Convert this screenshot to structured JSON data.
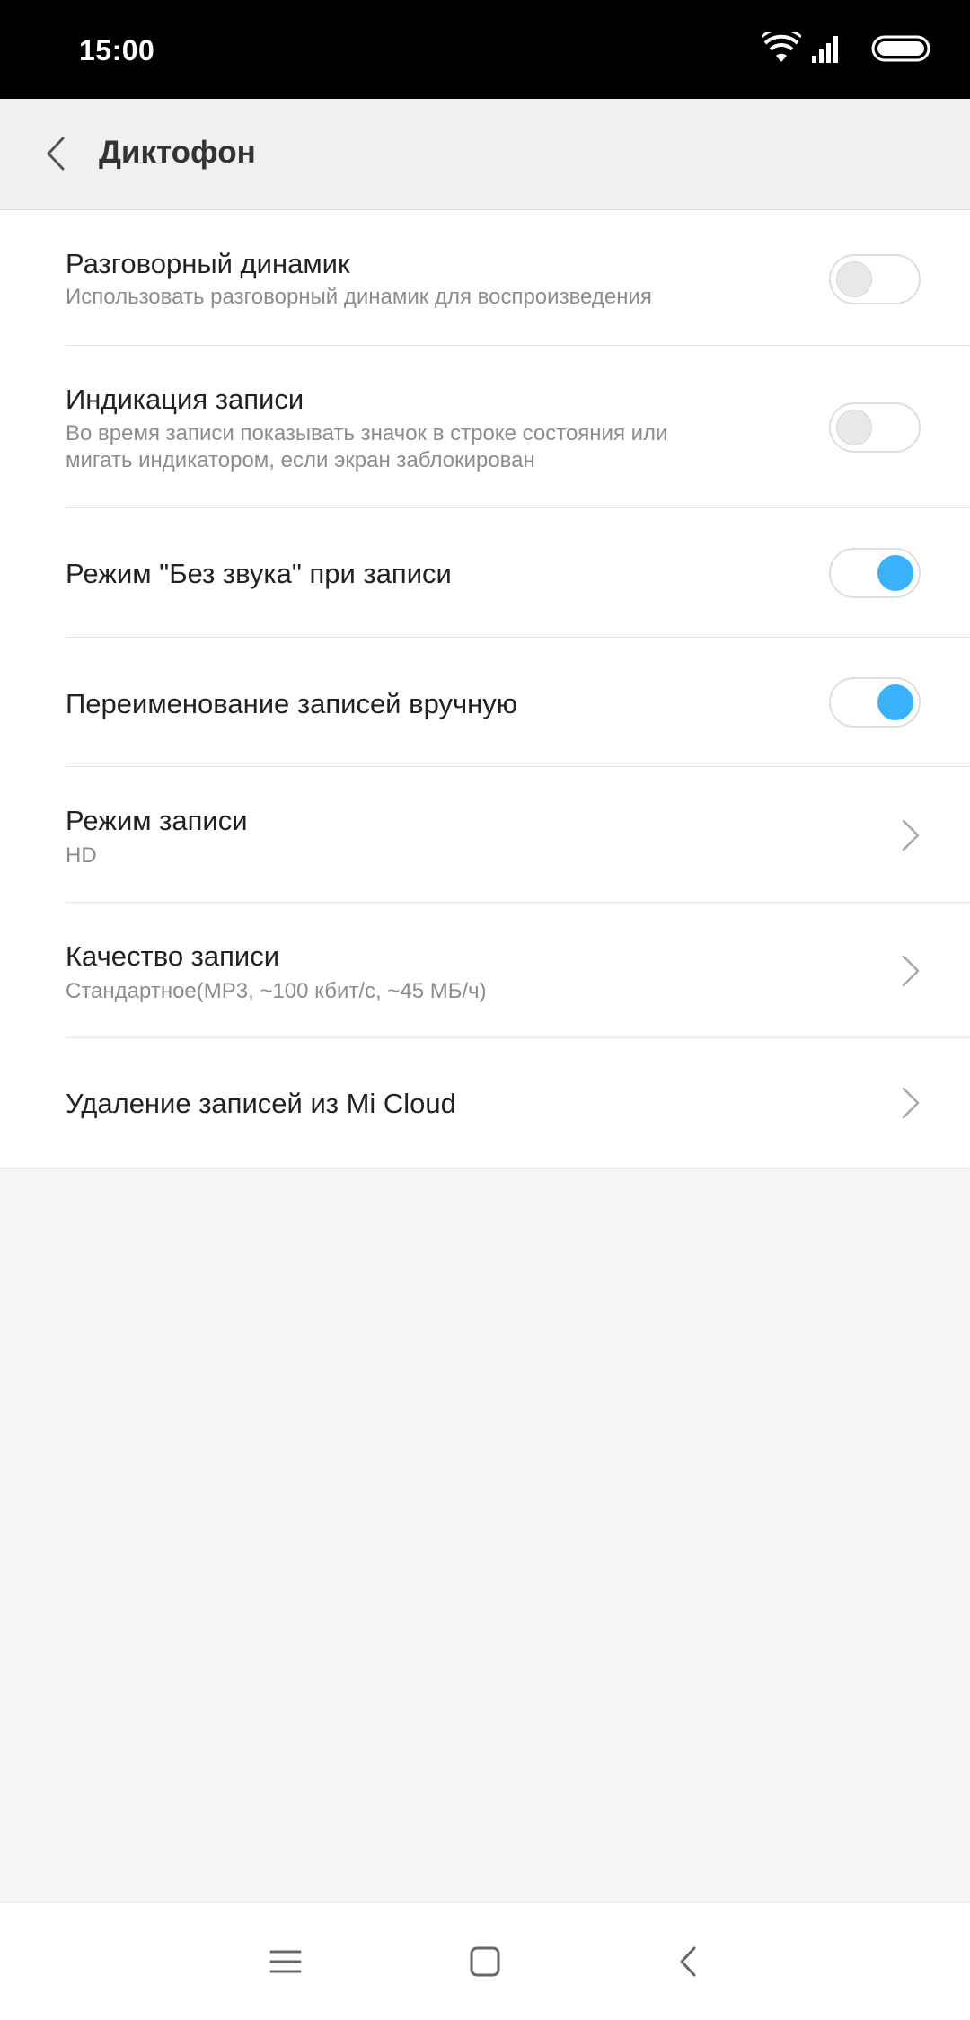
{
  "status_bar": {
    "time": "15:00",
    "icons": [
      "wifi-icon",
      "signal-icon",
      "battery-icon"
    ]
  },
  "app_bar": {
    "title": "Диктофон",
    "back_icon": "back-arrow-icon"
  },
  "settings": {
    "items": [
      {
        "type": "toggle",
        "title": "Разговорный динамик",
        "subtitle": "Использовать разговорный динамик для воспроизведения",
        "enabled": false
      },
      {
        "type": "toggle",
        "title": "Индикация записи",
        "subtitle_line1": "Во время записи показывать значок в строке состояния или",
        "subtitle_line2": "мигать индикатором, если экран заблокирован",
        "enabled": false
      },
      {
        "type": "toggle",
        "title": "Режим \"Без звука\" при записи",
        "enabled": true
      },
      {
        "type": "toggle",
        "title": "Переименование записей вручную",
        "enabled": true
      },
      {
        "type": "link",
        "title": "Режим записи",
        "subtitle": "HD"
      },
      {
        "type": "link",
        "title": "Качество записи",
        "subtitle": "Стандартное(MP3, ~100 кбит/с, ~45 МБ/ч)"
      },
      {
        "type": "link",
        "title": "Удаление записей из Mi Cloud"
      }
    ]
  },
  "nav_bar": {
    "icons": [
      "menu-icon",
      "home-icon",
      "back-icon"
    ]
  },
  "colors": {
    "accent": "#3ab1fb",
    "status_bar_bg": "#000000",
    "app_bar_bg": "#f0f0f0",
    "page_bg": "#f5f5f5"
  }
}
